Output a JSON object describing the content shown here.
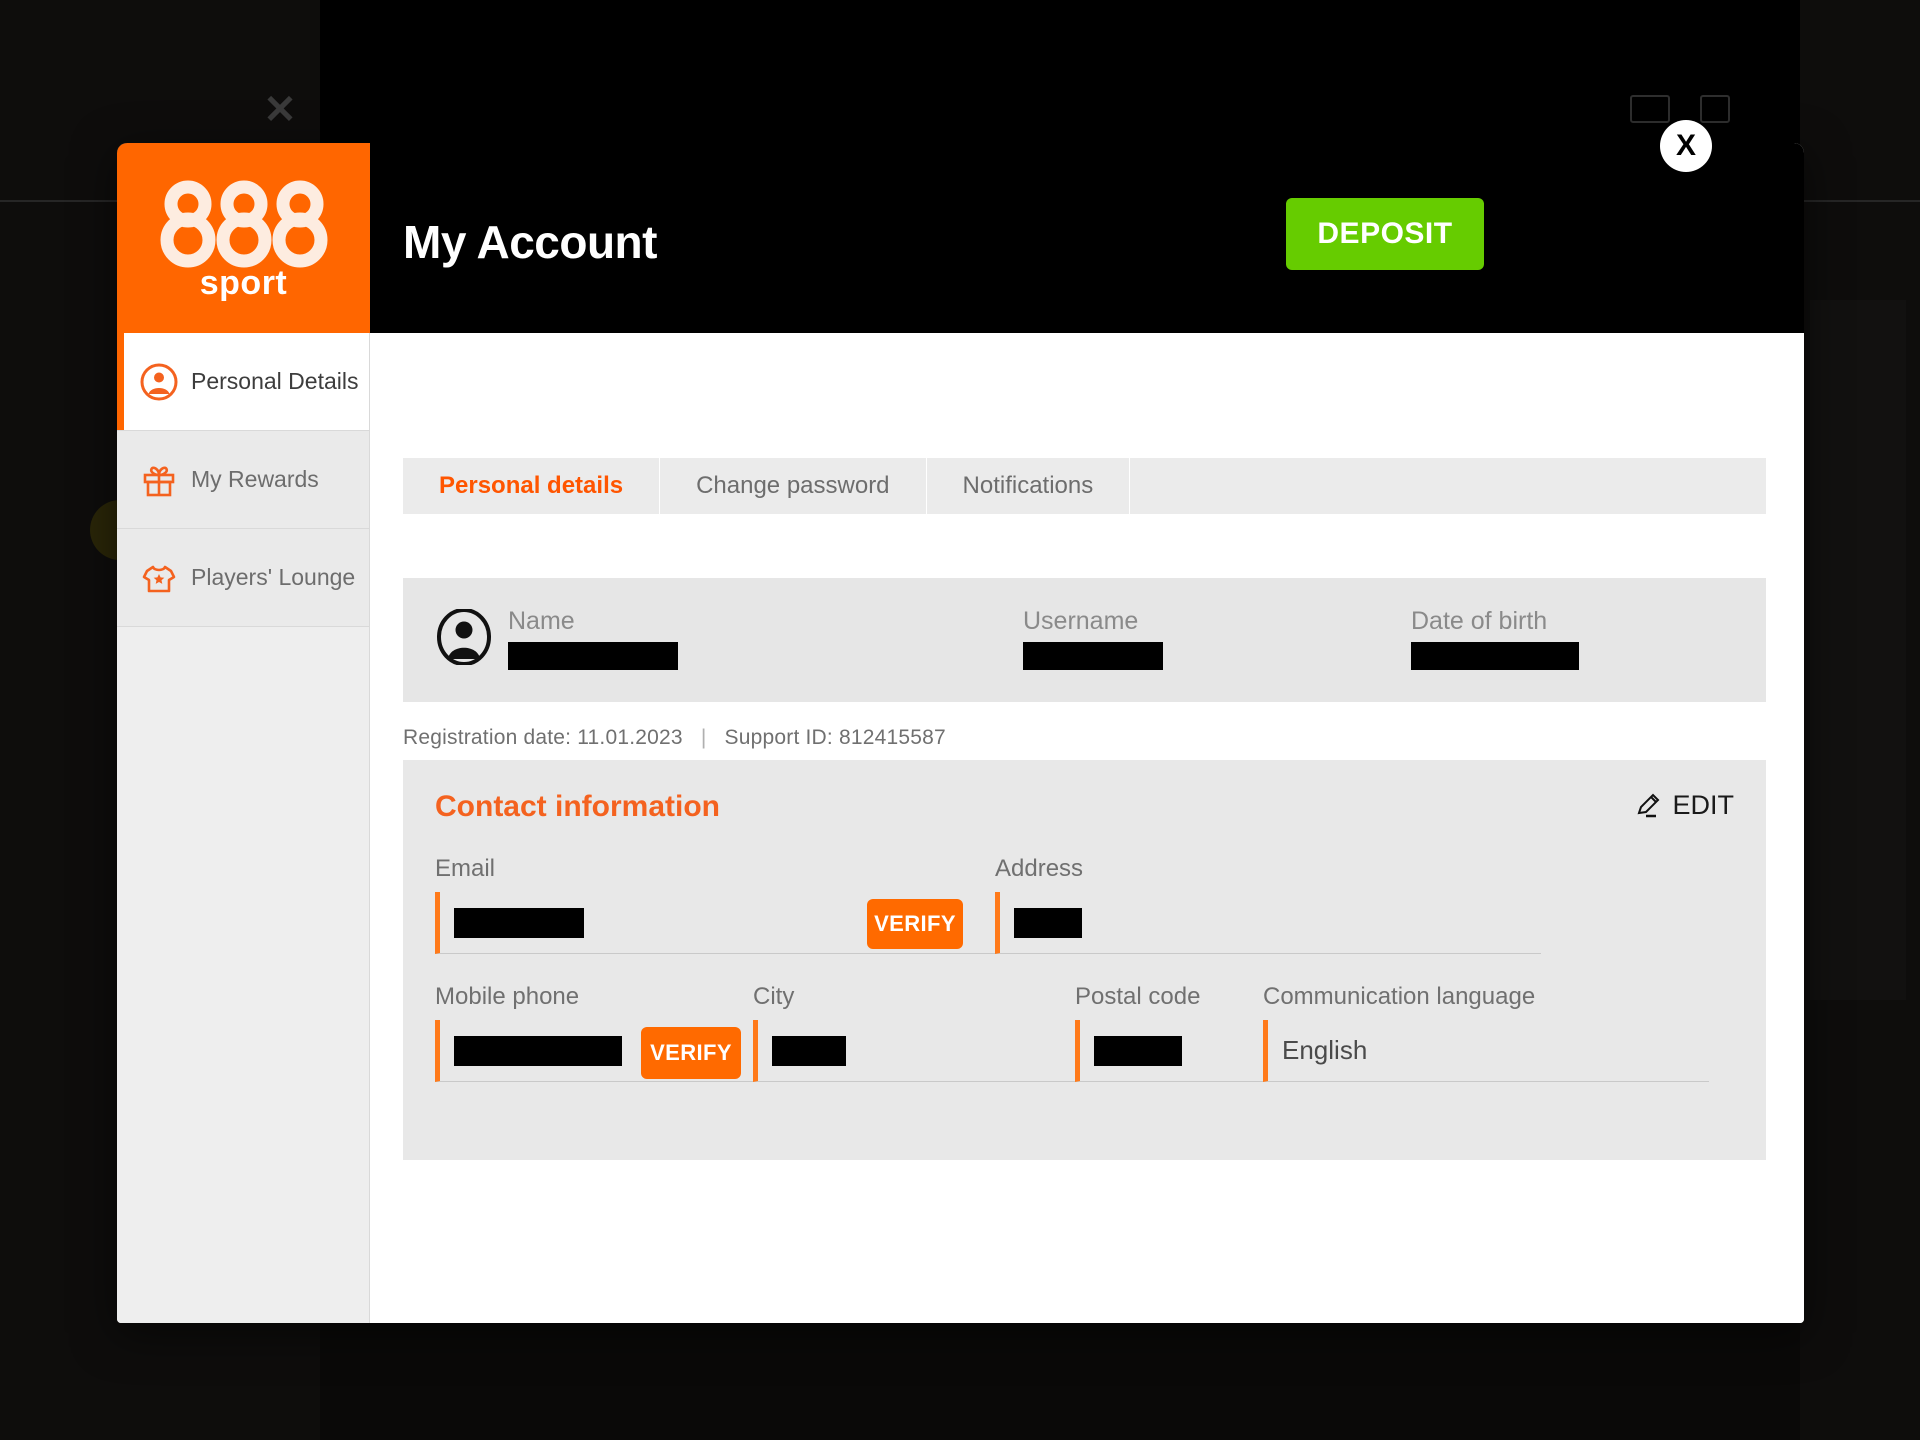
{
  "brand": {
    "logo_text": "888",
    "logo_subtext": "sport"
  },
  "header": {
    "title": "My Account",
    "deposit_label": "DEPOSIT",
    "close_label": "X",
    "accent_orange": "#ff6600",
    "deposit_green": "#66cc00"
  },
  "sidebar": {
    "items": [
      {
        "label": "Personal Details",
        "icon": "user-circle-icon",
        "active": true
      },
      {
        "label": "My Rewards",
        "icon": "gift-icon",
        "active": false
      },
      {
        "label": "Players' Lounge",
        "icon": "jersey-icon",
        "active": false
      }
    ]
  },
  "tabs": [
    {
      "label": "Personal details",
      "active": true
    },
    {
      "label": "Change password",
      "active": false
    },
    {
      "label": "Notifications",
      "active": false
    }
  ],
  "profile": {
    "avatar_icon": "avatar-icon",
    "fields": [
      {
        "label": "Name",
        "value": "",
        "redacted": true
      },
      {
        "label": "Username",
        "value": "",
        "redacted": true
      },
      {
        "label": "Date of birth",
        "value": "",
        "redacted": true
      }
    ],
    "registration_label": "Registration date: 11.01.2023",
    "separator": "|",
    "support_label": "Support ID: 812415587"
  },
  "contact": {
    "title": "Contact information",
    "edit_label": "EDIT",
    "edit_icon": "pencil-icon",
    "verify_label": "VERIFY",
    "fields": {
      "email": {
        "label": "Email",
        "value": "",
        "redacted": true
      },
      "address": {
        "label": "Address",
        "value": "",
        "redacted": true
      },
      "mobile_phone": {
        "label": "Mobile phone",
        "value": "",
        "redacted": true
      },
      "city": {
        "label": "City",
        "value": "",
        "redacted": true
      },
      "postal_code": {
        "label": "Postal code",
        "value": "",
        "redacted": true
      },
      "communication_language": {
        "label": "Communication language",
        "value": "English",
        "redacted": false
      }
    }
  }
}
